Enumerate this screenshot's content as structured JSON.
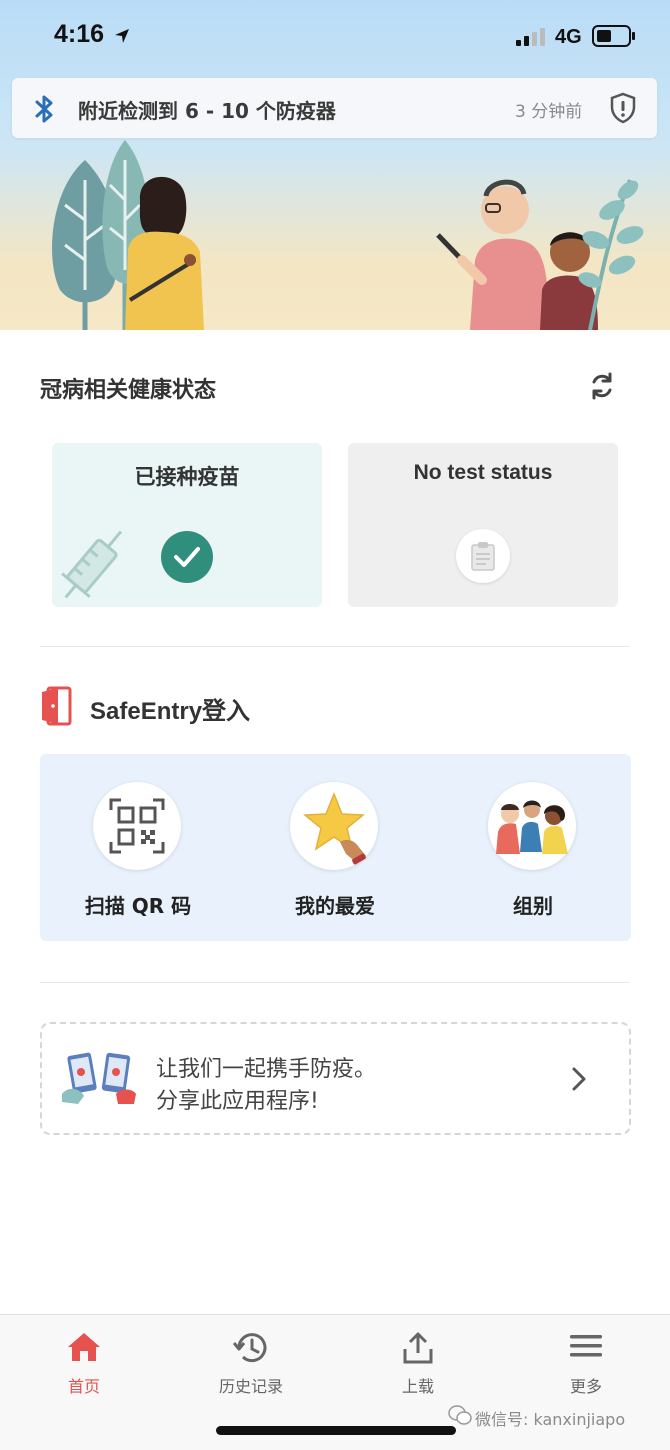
{
  "status_bar": {
    "time": "4:16",
    "network": "4G"
  },
  "bluetooth_banner": {
    "message": "附近检测到 6 - 10 个防疫器",
    "timestamp": "3 分钟前"
  },
  "health_status": {
    "title": "冠病相关健康状态",
    "vaccination_card": {
      "title": "已接种疫苗",
      "status_color": "#2f8f7c"
    },
    "test_card": {
      "title": "No test status"
    }
  },
  "safeentry": {
    "brand": "SafeEntry",
    "suffix": "登入",
    "actions": [
      {
        "label": "扫描 QR 码",
        "icon": "qr-code-icon"
      },
      {
        "label": "我的最爱",
        "icon": "star-icon"
      },
      {
        "label": "组别",
        "icon": "group-icon"
      }
    ]
  },
  "share": {
    "line1": "让我们一起携手防疫。",
    "line2": "分享此应用程序!"
  },
  "tabs": [
    {
      "label": "首页",
      "icon": "home-icon",
      "active": true
    },
    {
      "label": "历史记录",
      "icon": "history-icon",
      "active": false
    },
    {
      "label": "上载",
      "icon": "upload-icon",
      "active": false
    },
    {
      "label": "更多",
      "icon": "menu-icon",
      "active": false
    }
  ],
  "watermark": "微信号: kanxinjiapo",
  "colors": {
    "accent": "#e5524f",
    "teal": "#2f8f7c",
    "bluetooth": "#2a6fb5",
    "panel": "#e9f2fc"
  }
}
